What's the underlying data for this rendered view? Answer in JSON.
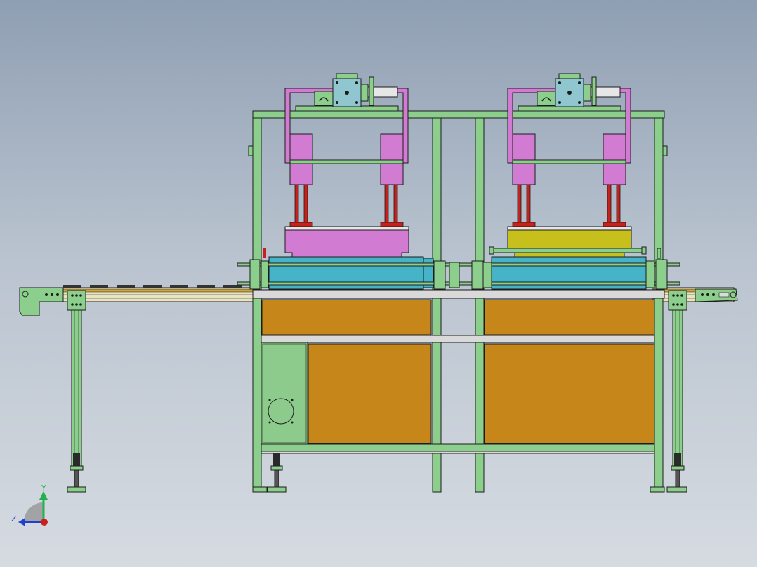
{
  "viewport": {
    "background_top": "#8f9fb3",
    "background_bottom": "#d6dbe1"
  },
  "colors": {
    "frame": "#8ccf8c",
    "frame_dark": "#4d8f4d",
    "cabinet": "#c6861a",
    "cylinder": "#d27bd2",
    "press_pad": "#d27bd2",
    "press_pad_yellow": "#c6bf1c",
    "guide_rod": "#c8201a",
    "mold": "#45b4c9",
    "electrical_box": "#8ccb8c",
    "outline": "#1c1c1c"
  },
  "triad": {
    "y_label": "Y",
    "z_label": "Z",
    "y_color": "#22b14c",
    "z_color": "#1f3fd0",
    "x_color": "#d01c1c"
  }
}
